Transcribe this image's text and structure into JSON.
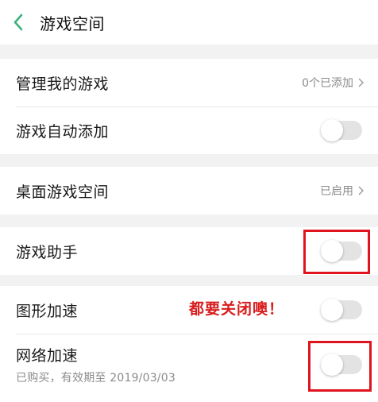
{
  "header": {
    "title": "游戏空间"
  },
  "rows": {
    "manage_games": {
      "label": "管理我的游戏",
      "value": "0个已添加"
    },
    "auto_add": {
      "label": "游戏自动添加",
      "enabled": false
    },
    "desktop_space": {
      "label": "桌面游戏空间",
      "value": "已启用"
    },
    "assistant": {
      "label": "游戏助手",
      "enabled": false
    },
    "graphics_accel": {
      "label": "图形加速",
      "enabled": false
    },
    "network_accel": {
      "label": "网络加速",
      "subtitle": "已购买，有效期至 2019/03/03",
      "enabled": false
    }
  },
  "annotation": {
    "text": "都要关闭噢！"
  },
  "colors": {
    "accent": "#3bb27a",
    "highlight": "#e0141e",
    "annotation": "#d81e1e"
  }
}
